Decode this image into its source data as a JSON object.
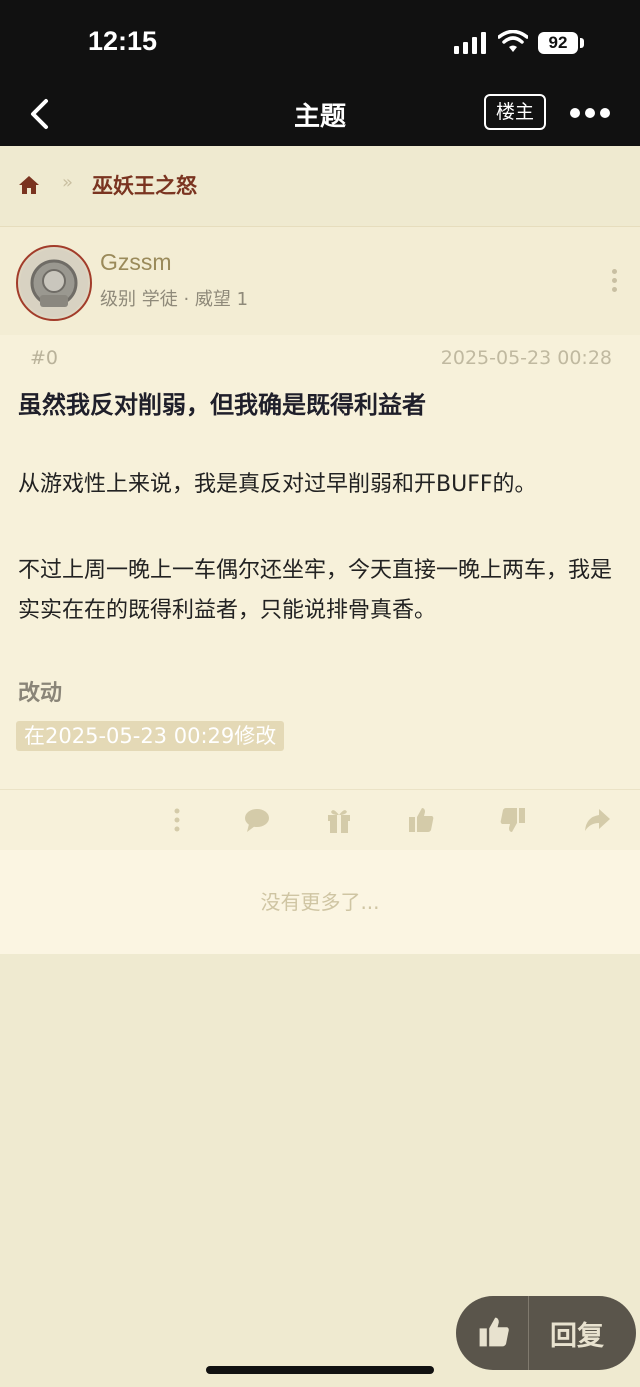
{
  "status_bar": {
    "time": "12:15",
    "battery": "92",
    "icons": [
      "cellular-signal-icon",
      "wifi-icon",
      "battery-icon"
    ]
  },
  "nav": {
    "title": "主题",
    "op_button": "楼主",
    "icons": [
      "back-arrow-icon",
      "more-dots-icon"
    ]
  },
  "breadcrumb": {
    "separator": "»",
    "forum": "巫妖王之怒",
    "icons": [
      "home-icon"
    ]
  },
  "post": {
    "author": {
      "name": "Gzssm",
      "level_line": "级别 学徒 · 威望 1"
    },
    "floor": "#0",
    "time": "2025-05-23 00:28",
    "title": "虽然我反对削弱，但我确是既得利益者",
    "paragraphs": [
      "从游戏性上来说，我是真反对过早削弱和开BUFF的。",
      "不过上周一晚上一车偶尔还坐牢，今天直接一晚上两车，我是实实在在的既得利益者，只能说排骨真香。"
    ],
    "edit_label": "改动",
    "edit_note": "在2025-05-23 00:29修改",
    "action_icons": [
      "more-vertical-icon",
      "comment-icon",
      "gift-icon",
      "thumbs-up-icon",
      "thumbs-down-icon",
      "share-icon"
    ]
  },
  "footer": {
    "no_more": "没有更多了..."
  },
  "floating": {
    "reply_label": "回复",
    "icons": [
      "thumbs-up-icon"
    ]
  },
  "colors": {
    "background": "#efead0",
    "card": "#f7f1da",
    "header_bar": "#111111",
    "accent_forum": "#7a3420",
    "username": "#9a8a5a",
    "pill": "#5a554b"
  }
}
